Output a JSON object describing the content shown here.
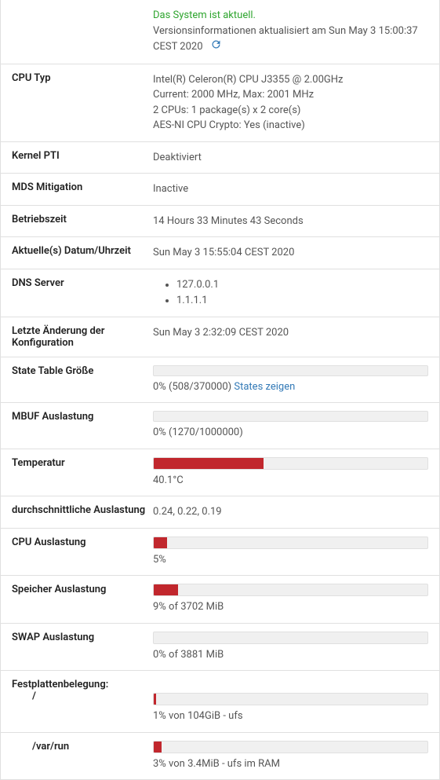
{
  "status": {
    "ok_text": "Das System ist aktuell.",
    "version_info": "Versionsinformationen aktualisiert am Sun May 3 15:00:37 CEST 2020"
  },
  "cpu_type": {
    "label": "CPU Typ",
    "line1": "Intel(R) Celeron(R) CPU J3355 @ 2.00GHz",
    "line2": "Current: 2000 MHz, Max: 2001 MHz",
    "line3": "2 CPUs: 1 package(s) x 2 core(s)",
    "line4": "AES-NI CPU Crypto: Yes (inactive)"
  },
  "kernel_pti": {
    "label": "Kernel PTI",
    "value": "Deaktiviert"
  },
  "mds": {
    "label": "MDS Mitigation",
    "value": "Inactive"
  },
  "uptime": {
    "label": "Betriebszeit",
    "value": "14 Hours 33 Minutes 43 Seconds"
  },
  "datetime": {
    "label": "Aktuelle(s) Datum/Uhrzeit",
    "value": "Sun May 3 15:55:04 CEST 2020"
  },
  "dns": {
    "label": "DNS Server",
    "items": [
      "127.0.0.1",
      "1.1.1.1"
    ]
  },
  "last_config": {
    "label": "Letzte Änderung der Konfiguration",
    "value": "Sun May 3 2:32:09 CEST 2020"
  },
  "state_table": {
    "label": "State Table Größe",
    "text": "0% (508/370000) ",
    "link": "States zeigen",
    "pct": 0
  },
  "mbuf": {
    "label": "MBUF Auslastung",
    "text": "0% (1270/1000000)",
    "pct": 0
  },
  "temp": {
    "label": "Temperatur",
    "text": "40.1°C",
    "pct": 40
  },
  "load": {
    "label": "durchschnittliche Auslastung",
    "value": "0.24, 0.22, 0.19"
  },
  "cpu_usage": {
    "label": "CPU Auslastung",
    "text": "5%",
    "pct": 5
  },
  "mem": {
    "label": "Speicher Auslastung",
    "text": "9% of 3702 MiB",
    "pct": 9
  },
  "swap": {
    "label": "SWAP Auslastung",
    "text": "0% of 3881 MiB",
    "pct": 0
  },
  "disk": {
    "label": "Festplattenbelegung:",
    "root_label": "/",
    "root_text": "1% von 104GiB - ufs",
    "root_pct": 1,
    "varrun_label": "/var/run",
    "varrun_text": "3% von 3.4MiB - ufs im RAM",
    "varrun_pct": 3
  }
}
